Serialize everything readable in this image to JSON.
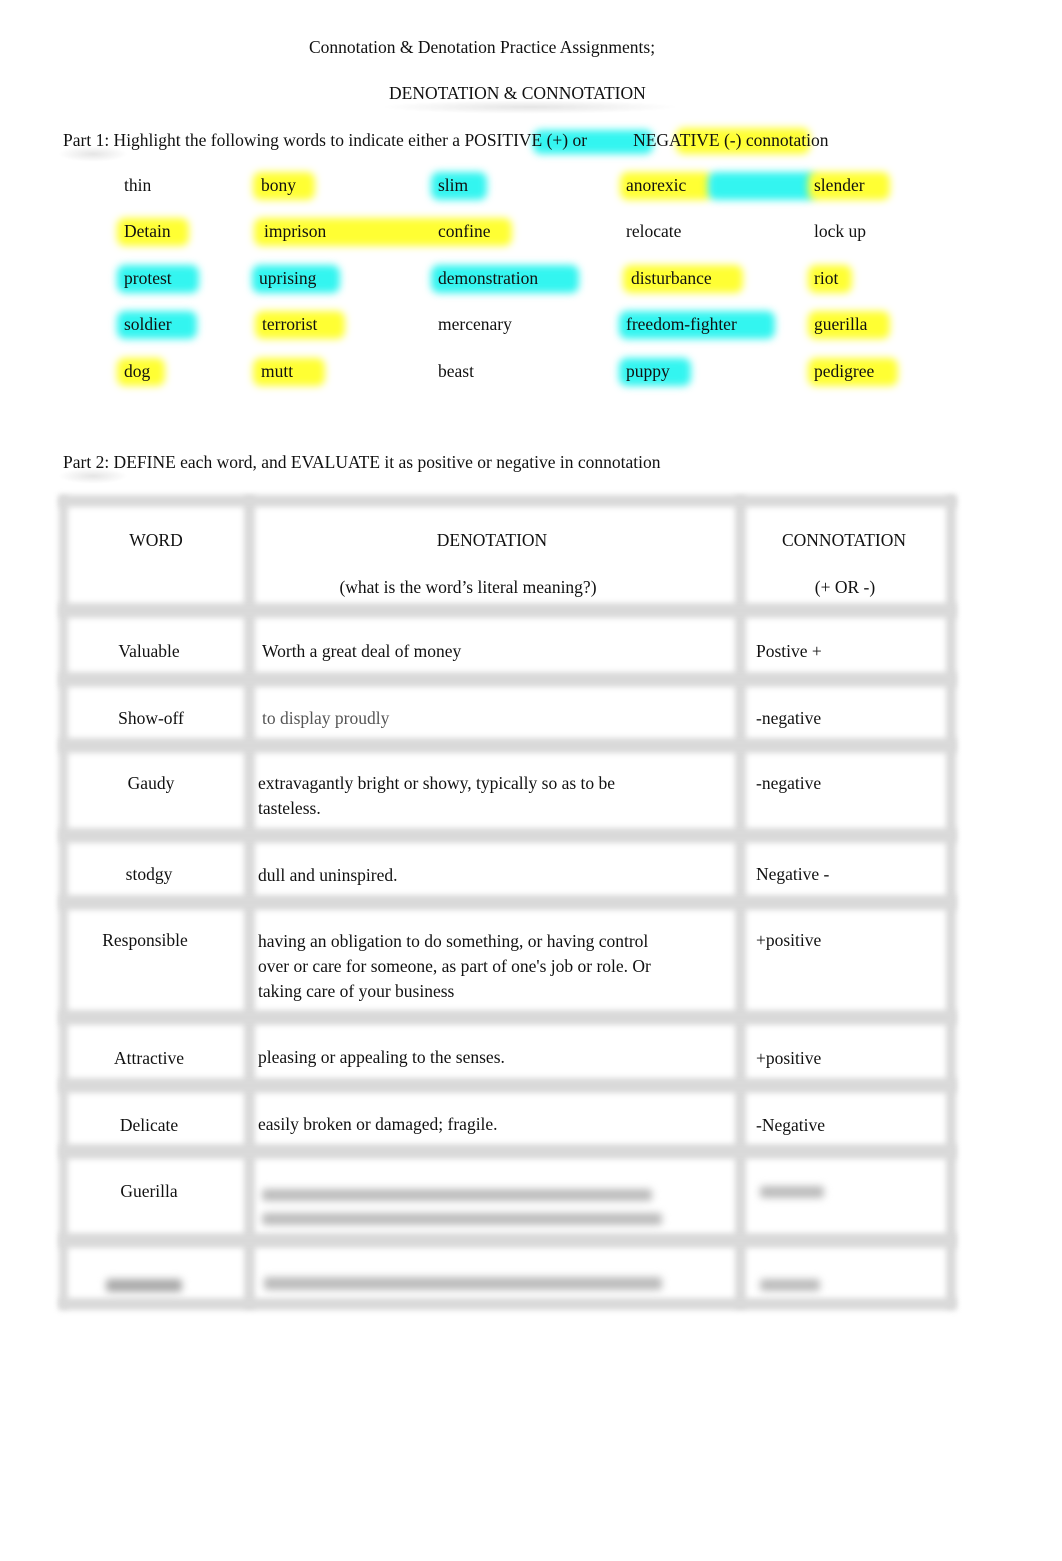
{
  "document": {
    "title": "Connotation & Denotation Practice Assignments;",
    "subtitle": "DENOTATION & CONNOTATION"
  },
  "part1": {
    "instruction_before": "Part 1: Highlight the following words to indicate either a PO",
    "positive_label": "SITIVE (+) or",
    "negative_label": "NEGATIVE (-)",
    "instruction_after": " connotation",
    "highlight_colors": {
      "positive": "#33f5f0",
      "negative": "#ffff33"
    },
    "rows": [
      [
        {
          "text": "thin",
          "highlight": "none"
        },
        {
          "text": "bony",
          "highlight": "negative"
        },
        {
          "text": "slim",
          "highlight": "positive"
        },
        {
          "text": "anorexic",
          "highlight": "negative"
        },
        {
          "text": "slender",
          "highlight": "negative"
        }
      ],
      [
        {
          "text": "Detain",
          "highlight": "negative"
        },
        {
          "text": "imprison",
          "highlight": "negative"
        },
        {
          "text": "confine",
          "highlight": "negative"
        },
        {
          "text": "relocate",
          "highlight": "none"
        },
        {
          "text": "lock up",
          "highlight": "none"
        }
      ],
      [
        {
          "text": "protest",
          "highlight": "positive"
        },
        {
          "text": "uprising",
          "highlight": "positive"
        },
        {
          "text": "demonstration",
          "highlight": "positive"
        },
        {
          "text": "disturbance",
          "highlight": "negative"
        },
        {
          "text": "riot",
          "highlight": "negative"
        }
      ],
      [
        {
          "text": "soldier",
          "highlight": "positive"
        },
        {
          "text": "terrorist",
          "highlight": "negative"
        },
        {
          "text": "mercenary",
          "highlight": "none"
        },
        {
          "text": "freedom-fighter",
          "highlight": "positive"
        },
        {
          "text": "guerilla",
          "highlight": "negative"
        }
      ],
      [
        {
          "text": "dog",
          "highlight": "negative"
        },
        {
          "text": "mutt",
          "highlight": "negative"
        },
        {
          "text": "beast",
          "highlight": "none"
        },
        {
          "text": "puppy",
          "highlight": "positive"
        },
        {
          "text": "pedigree",
          "highlight": "negative"
        }
      ]
    ]
  },
  "part2": {
    "instruction": "Part 2: DEFINE each word, and EVALUATE it as positive or negative in connotation",
    "table": {
      "headers": {
        "word": "WORD",
        "denotation": "DENOTATION",
        "denotation_sub": "(what is the word’s literal meaning?)",
        "connotation": "CONNOTATION",
        "connotation_sub": "(+ OR -)"
      },
      "rows": [
        {
          "word": "Valuable",
          "denotation": "Worth a great deal of money",
          "connotation": "Postive +"
        },
        {
          "word": "Show-off",
          "denotation": "to display proudly",
          "connotation": "-negative"
        },
        {
          "word": "Gaudy",
          "denotation": " extravagantly bright or showy, typically so as to be tasteless.",
          "connotation": "-negative"
        },
        {
          "word": "stodgy",
          "denotation": " dull and uninspired.",
          "connotation": "Negative -"
        },
        {
          "word": "Responsible",
          "denotation": " having an obligation to do something, or having control over or care for someone, as part of one's job or role. Or taking care of your business",
          "connotation": "+positive"
        },
        {
          "word": "Attractive",
          "denotation": " pleasing or appealing to the senses.",
          "connotation": "+positive"
        },
        {
          "word": "Delicate",
          "denotation": " easily broken or damaged; fragile.",
          "connotation": "-Negative"
        },
        {
          "word": "Guerilla",
          "denotation": "[blurred text]",
          "connotation": "[blurred]"
        },
        {
          "word": "[blurred]",
          "denotation": "[blurred text]",
          "connotation": "[blurred]"
        }
      ]
    }
  }
}
